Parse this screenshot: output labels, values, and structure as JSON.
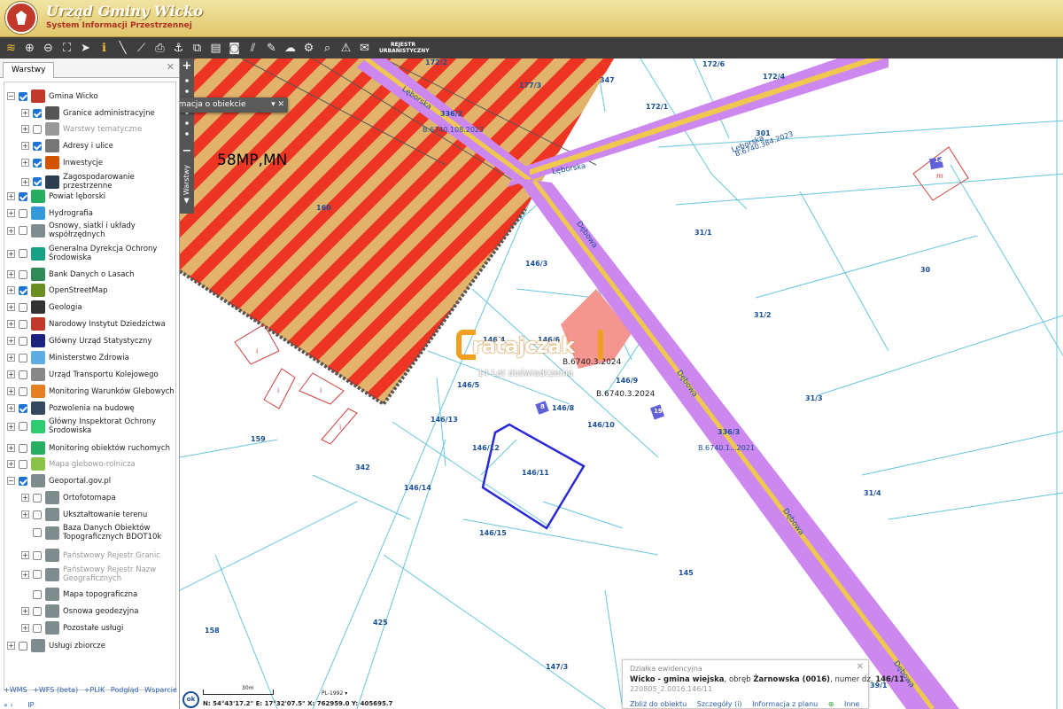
{
  "app": {
    "title": "Urząd Gminy Wicko",
    "subtitle": "System Informacji Przestrzennej"
  },
  "toolbar": {
    "icons": [
      "layers-icon",
      "zoom-in-icon",
      "zoom-out-icon",
      "zoom-extent-icon",
      "select-icon",
      "info-icon",
      "measure-line-icon",
      "measure-area-icon",
      "print-icon",
      "anchor-icon",
      "export-icon",
      "note-icon",
      "comment-icon",
      "hatch-icon",
      "edit-icon",
      "cloud-icon",
      "settings-icon",
      "search-map-icon",
      "warning-icon",
      "chat-icon"
    ],
    "register_label": "REJESTR URBANISTYCZNY"
  },
  "sidebar": {
    "tab_label": "Warstwy",
    "layers": [
      {
        "label": "Gmina Wicko",
        "level": 0,
        "expand": "−",
        "checked": true,
        "color": "#c0392b",
        "grey": false
      },
      {
        "label": "Granice administracyjne",
        "level": 1,
        "expand": "+",
        "checked": true,
        "color": "#555555",
        "grey": false
      },
      {
        "label": "Warstwy tematyczne",
        "level": 1,
        "expand": "+",
        "checked": false,
        "color": "#999999",
        "grey": true
      },
      {
        "label": "Adresy i ulice",
        "level": 1,
        "expand": "+",
        "checked": true,
        "color": "#777777",
        "grey": false
      },
      {
        "label": "Inwestycje",
        "level": 1,
        "expand": "+",
        "checked": true,
        "color": "#d35400",
        "grey": false
      },
      {
        "label": "Zagospodarowanie przestrzenne",
        "level": 1,
        "expand": "+",
        "checked": true,
        "color": "#2c3e50",
        "grey": false
      },
      {
        "label": "Powiat lęborski",
        "level": 0,
        "expand": "+",
        "checked": true,
        "color": "#27ae60",
        "grey": false
      },
      {
        "label": "Hydrografia",
        "level": 0,
        "expand": "+",
        "checked": false,
        "color": "#3498db",
        "grey": false
      },
      {
        "label": "Osnowy, siatki i układy współrzędnych",
        "level": 0,
        "expand": "+",
        "checked": false,
        "color": "#7f8c8d",
        "grey": false
      },
      {
        "label": "Generalna Dyrekcja Ochrony Środowiska",
        "level": 0,
        "expand": "+",
        "checked": false,
        "color": "#16a085",
        "grey": false
      },
      {
        "label": "Bank Danych o Lasach",
        "level": 0,
        "expand": "+",
        "checked": false,
        "color": "#2e8b57",
        "grey": false
      },
      {
        "label": "OpenStreetMap",
        "level": 0,
        "expand": "+",
        "checked": true,
        "color": "#6b8e23",
        "grey": false
      },
      {
        "label": "Geologia",
        "level": 0,
        "expand": "+",
        "checked": false,
        "color": "#333333",
        "grey": false
      },
      {
        "label": "Narodowy Instytut Dziedzictwa",
        "level": 0,
        "expand": "+",
        "checked": false,
        "color": "#c0392b",
        "grey": false
      },
      {
        "label": "Główny Urząd Statystyczny",
        "level": 0,
        "expand": "+",
        "checked": false,
        "color": "#1a237e",
        "grey": false
      },
      {
        "label": "Ministerstwo Zdrowia",
        "level": 0,
        "expand": "+",
        "checked": false,
        "color": "#5dade2",
        "grey": false
      },
      {
        "label": "Urząd Transportu Kolejowego",
        "level": 0,
        "expand": "+",
        "checked": false,
        "color": "#888888",
        "grey": false
      },
      {
        "label": "Monitoring Warunków Glebowych",
        "level": 0,
        "expand": "+",
        "checked": false,
        "color": "#e67e22",
        "grey": false
      },
      {
        "label": "Pozwolenia na budowę",
        "level": 0,
        "expand": "+",
        "checked": true,
        "color": "#34495e",
        "grey": false
      },
      {
        "label": "Główny Inspektorat Ochrony Środowiska",
        "level": 0,
        "expand": "+",
        "checked": false,
        "color": "#2ecc71",
        "grey": false
      },
      {
        "label": "Monitoring obiektów ruchomych",
        "level": 0,
        "expand": "+",
        "checked": false,
        "color": "#27ae60",
        "grey": false
      },
      {
        "label": "Mapa glebowo-rolnicza",
        "level": 0,
        "expand": "+",
        "checked": false,
        "color": "#8bc34a",
        "grey": true
      },
      {
        "label": "Geoportal.gov.pl",
        "level": 0,
        "expand": "−",
        "checked": true,
        "color": "#7f8c8d",
        "grey": false
      },
      {
        "label": "Ortofotomapa",
        "level": 1,
        "expand": "+",
        "checked": false,
        "color": "#7f8c8d",
        "grey": false
      },
      {
        "label": "Ukształtowanie terenu",
        "level": 1,
        "expand": "+",
        "checked": false,
        "color": "#7f8c8d",
        "grey": false
      },
      {
        "label": "Baza Danych Obiektów Topograficznych BDOT10k",
        "level": 1,
        "expand": "",
        "checked": false,
        "color": "#7f8c8d",
        "grey": false
      },
      {
        "label": "Państwowy Rejestr Granic",
        "level": 1,
        "expand": "+",
        "checked": false,
        "color": "#7f8c8d",
        "grey": true
      },
      {
        "label": "Państwowy Rejestr Nazw Geograficznych",
        "level": 1,
        "expand": "+",
        "checked": false,
        "color": "#7f8c8d",
        "grey": true
      },
      {
        "label": "Mapa topograficzna",
        "level": 1,
        "expand": "",
        "checked": false,
        "color": "#7f8c8d",
        "grey": false
      },
      {
        "label": "Osnowa geodezyjna",
        "level": 1,
        "expand": "+",
        "checked": false,
        "color": "#7f8c8d",
        "grey": false
      },
      {
        "label": "Pozostałe usługi",
        "level": 1,
        "expand": "+",
        "checked": false,
        "color": "#7f8c8d",
        "grey": false
      },
      {
        "label": "Usługi zbiorcze",
        "level": 0,
        "expand": "+",
        "checked": false,
        "color": "#7f8c8d",
        "grey": false
      }
    ],
    "bottom_links": [
      "+WMS",
      "+WFS (beta)",
      "+PLIK",
      "Podgląd",
      "Wsparcie"
    ],
    "pager_prev": "«",
    "pager_next": "›",
    "pager_ip": "IP"
  },
  "map": {
    "side_tab_label": "Warstwy",
    "info_panel_label": "Informacja o obiekcie",
    "zone_label": "58MP,MN",
    "roads": [
      {
        "id": "road-leborska-1",
        "label": "Lęborska"
      },
      {
        "id": "road-leborska-2",
        "label": "Lęborska"
      },
      {
        "id": "road-leborska-3",
        "label": "Lęborska"
      },
      {
        "id": "road-debowa-1",
        "label": "Dębowa"
      },
      {
        "id": "road-debowa-2",
        "label": "Dębowa"
      },
      {
        "id": "road-debowa-3",
        "label": "Dębowa"
      },
      {
        "id": "road-debowa-4",
        "label": "Dębowa"
      }
    ],
    "parcels": [
      "172/2",
      "172/6",
      "172/4",
      "177/3",
      "347",
      "172/1",
      "336/2",
      "301",
      "160",
      "31/1",
      "30",
      "146/3",
      "31/2",
      "146/4",
      "146/6",
      "146/5",
      "146/9",
      "146/13",
      "146/8",
      "146/10",
      "31/3",
      "336/3",
      "159",
      "146/12",
      "146/11",
      "342",
      "146/14",
      "31/4",
      "146/15",
      "145",
      "158",
      "425",
      "147/3",
      "39/1"
    ],
    "permits": [
      "B.6740.108.2023",
      "B.6740.384.2023",
      "B.6740.3.2024",
      "B.6740.3.2024",
      "B.6740.1...2021"
    ],
    "markers": [
      "14",
      "m",
      "i",
      "i",
      "i",
      "i",
      "8",
      "19"
    ],
    "watermark_name": "ratajczak",
    "watermark_tagline": "14 Lat doświadczenia",
    "scale_label": "30m",
    "crs": "PL-1992",
    "coords": "N: 54°43'17.2\"  E: 17°32'07.5\"   X: 762959.0   Y: 405695.7",
    "ok_label": "ok"
  },
  "info_card": {
    "type": "Działka ewidencyjna",
    "place": "Wicko - gmina wiejska",
    "text_mid": ", obręb ",
    "district": "Żarnowska (0016)",
    "text_num": ", numer dz. ",
    "number": "146/11",
    "identifier": "220805_2.0016.146/11",
    "links": [
      "Zbliż do obiektu",
      "Szczegóły (i)",
      "Informacja z planu",
      "Inne"
    ]
  },
  "colors": {
    "zone_red": "#ee3524",
    "zone_tan": "#e2b36a",
    "road_purple": "#cc88ee",
    "road_yellow": "#f0c850",
    "parcel_line": "#66c6dd",
    "selected_parcel": "#2a2ad4",
    "header_gold": "#e0c66b",
    "toolbar_dark": "#3e3e3e"
  }
}
